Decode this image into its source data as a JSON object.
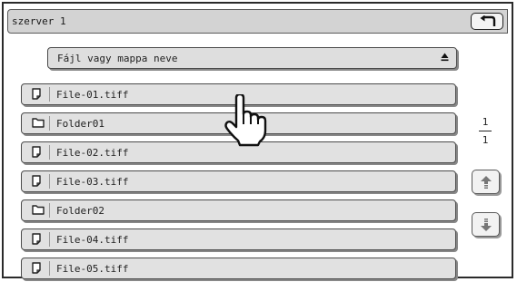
{
  "header": {
    "title": "szerver 1"
  },
  "sort": {
    "label": "Fájl vagy mappa neve"
  },
  "items": [
    {
      "name": "File-01.tiff",
      "type": "file"
    },
    {
      "name": "Folder01",
      "type": "folder"
    },
    {
      "name": "File-02.tiff",
      "type": "file"
    },
    {
      "name": "File-03.tiff",
      "type": "file"
    },
    {
      "name": "Folder02",
      "type": "folder"
    },
    {
      "name": "File-04.tiff",
      "type": "file"
    },
    {
      "name": "File-05.tiff",
      "type": "file"
    }
  ],
  "pager": {
    "current": "1",
    "total": "1"
  },
  "icons": {
    "back": "back-arrow-icon",
    "sort": "sort-ascending-icon",
    "file": "file-icon",
    "folder": "folder-icon",
    "up": "scroll-up-icon",
    "down": "scroll-down-icon",
    "pointer": "hand-pointer-icon"
  }
}
